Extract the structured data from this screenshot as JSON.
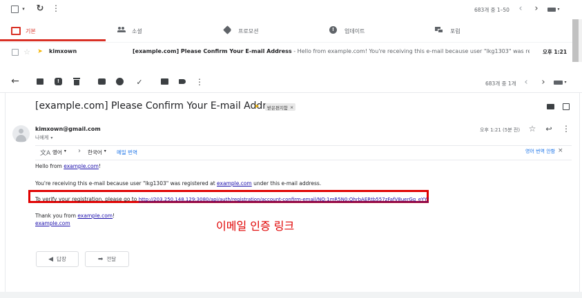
{
  "inbox": {
    "counter": "683개 중 1–50",
    "tabs": [
      {
        "label": "기본",
        "color": "#d93025"
      },
      {
        "label": "소셜",
        "color": "#5f6368"
      },
      {
        "label": "프로모션",
        "color": "#5f6368"
      },
      {
        "label": "업데이트",
        "color": "#5f6368"
      },
      {
        "label": "포럼",
        "color": "#5f6368"
      }
    ],
    "row": {
      "sender": "kimxown",
      "subject": "[example.com] Please Confirm Your E-mail Address",
      "snippet": " - Hello from example.com! You're receiving this e-mail because user \"lkg1303\" was register...",
      "time": "오후 1:21"
    }
  },
  "message_view": {
    "counter": "683개 중 1개",
    "subject": "[example.com] Please Confirm Your E-mail Address",
    "label_chip": "받은편지함",
    "label_chip_close": "×",
    "sender_email": "kimxown@gmail.com",
    "to_line": "나에게",
    "time": "오후 1:21 (5분 전)",
    "translate": {
      "from_lang": "영어",
      "arrow": "›",
      "to_lang": "한국어",
      "translate_link": "메일 번역",
      "no_translate": "영어 번역 안함"
    },
    "body": {
      "greeting_prefix": "Hello from ",
      "greeting_link": "example.com",
      "greeting_suffix": "!",
      "line2_prefix": "You're receiving this e-mail because user \"lkg1303\" was registered at ",
      "line2_link": "example.com",
      "line2_suffix": " under this e-mail address.",
      "verify_prefix": "To verify your registration, please go to ",
      "verify_link": "http://203.250.148.129:3080/api/auth/registration/account-confirm-email/NQ:1mR5N0:QhrbAERtb557zFafV8uerGq_eYY/",
      "thanks_prefix": "Thank you from ",
      "thanks_link": "example.com",
      "thanks_suffix": "!",
      "signature_link": "example.com"
    },
    "annotation": "이메일 인증 링크",
    "annotation_color": "#e00000",
    "reply_label": "답장",
    "forward_label": "전달"
  }
}
